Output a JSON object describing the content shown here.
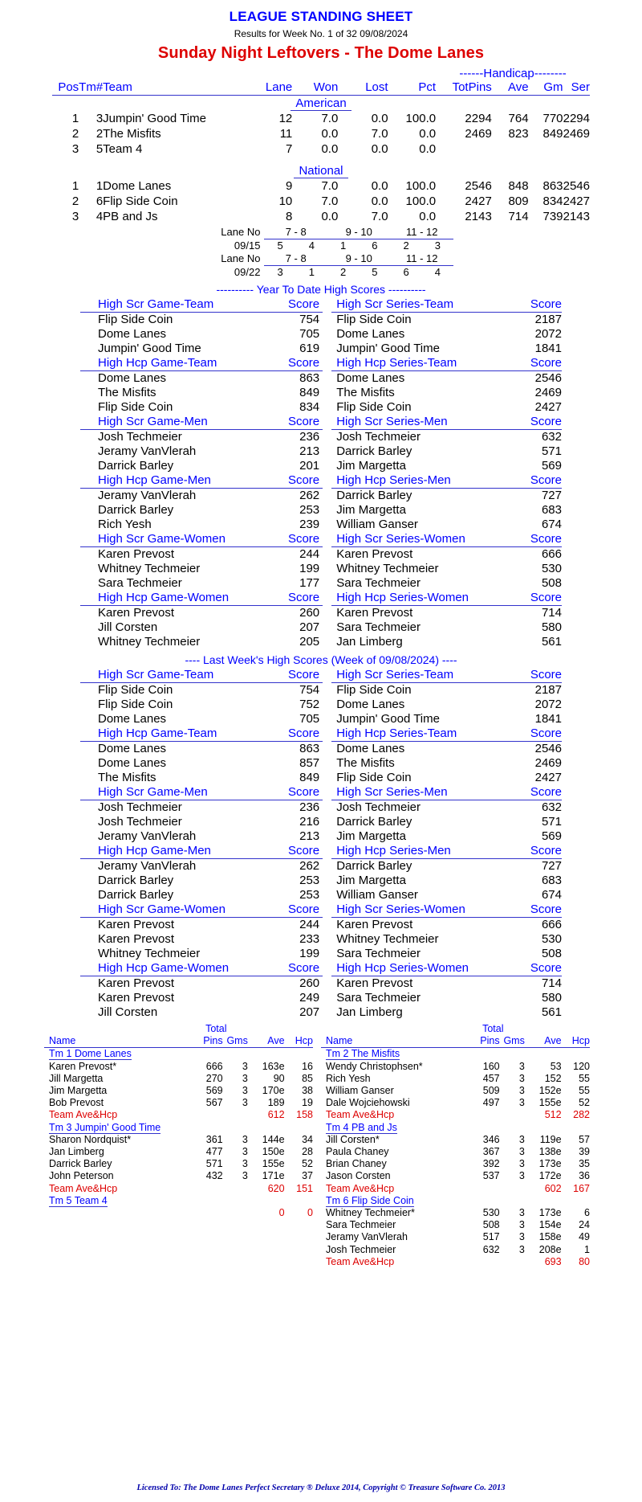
{
  "header": {
    "title": "LEAGUE STANDING SHEET",
    "subtitle": "Results for Week No. 1 of 32    09/08/2024",
    "league": "Sunday Night Leftovers - The Dome Lanes"
  },
  "standings": {
    "handicap_label": "------Handicap--------",
    "columns": {
      "pos": "Pos",
      "tm": "Tm#",
      "team": "Team",
      "lane": "Lane",
      "won": "Won",
      "lost": "Lost",
      "pct": "Pct",
      "totpins": "TotPins",
      "ave": "Ave",
      "gm": "Gm",
      "ser": "Ser"
    },
    "divisions": [
      {
        "name": "American",
        "rows": [
          {
            "pos": "1",
            "tm": "3",
            "team": "Jumpin' Good Time",
            "lane": "12",
            "won": "7.0",
            "lost": "0.0",
            "pct": "100.0",
            "totpins": "2294",
            "ave": "764",
            "gm": "770",
            "ser": "2294"
          },
          {
            "pos": "2",
            "tm": "2",
            "team": "The Misfits",
            "lane": "11",
            "won": "0.0",
            "lost": "7.0",
            "pct": "0.0",
            "totpins": "2469",
            "ave": "823",
            "gm": "849",
            "ser": "2469"
          },
          {
            "pos": "3",
            "tm": "5",
            "team": "Team 4",
            "lane": "7",
            "won": "0.0",
            "lost": "0.0",
            "pct": "0.0",
            "totpins": "",
            "ave": "",
            "gm": "",
            "ser": ""
          }
        ]
      },
      {
        "name": "National",
        "rows": [
          {
            "pos": "1",
            "tm": "1",
            "team": "Dome Lanes",
            "lane": "9",
            "won": "7.0",
            "lost": "0.0",
            "pct": "100.0",
            "totpins": "2546",
            "ave": "848",
            "gm": "863",
            "ser": "2546"
          },
          {
            "pos": "2",
            "tm": "6",
            "team": "Flip Side Coin",
            "lane": "10",
            "won": "7.0",
            "lost": "0.0",
            "pct": "100.0",
            "totpins": "2427",
            "ave": "809",
            "gm": "834",
            "ser": "2427"
          },
          {
            "pos": "3",
            "tm": "4",
            "team": "PB and Js",
            "lane": "8",
            "won": "0.0",
            "lost": "7.0",
            "pct": "0.0",
            "totpins": "2143",
            "ave": "714",
            "gm": "739",
            "ser": "2143"
          }
        ]
      }
    ]
  },
  "lane_schedule": {
    "lane_label": "Lane No",
    "pairs": [
      "7 - 8",
      "9 - 10",
      "11 - 12"
    ],
    "weeks": [
      {
        "date": "09/15",
        "teams": [
          "5",
          "4",
          "1",
          "6",
          "2",
          "3"
        ]
      },
      {
        "date": "09/22",
        "teams": [
          "3",
          "1",
          "2",
          "5",
          "6",
          "4"
        ]
      }
    ]
  },
  "ytd": {
    "banner": "---------- Year To Date High Scores ----------",
    "score_label": "Score",
    "blocks": [
      {
        "left_title": "High Scr Game-Team",
        "right_title": "High Scr Series-Team",
        "rows": [
          {
            "ln": "Flip Side Coin",
            "ls": "754",
            "rn": "Flip Side Coin",
            "rs": "2187"
          },
          {
            "ln": "",
            "ls": "",
            "rn": "",
            "rs": ""
          },
          {
            "ln": "Dome Lanes",
            "ls": "705",
            "rn": "Dome Lanes",
            "rs": "2072"
          },
          {
            "ln": "Jumpin' Good Time",
            "ls": "619",
            "rn": "Jumpin' Good Time",
            "rs": "1841"
          }
        ]
      },
      {
        "left_title": "High Hcp Game-Team",
        "right_title": "High Hcp Series-Team",
        "rows": [
          {
            "ln": "Dome Lanes",
            "ls": "863",
            "rn": "Dome Lanes",
            "rs": "2546"
          },
          {
            "ln": "The Misfits",
            "ls": "849",
            "rn": "The Misfits",
            "rs": "2469"
          },
          {
            "ln": "Flip Side Coin",
            "ls": "834",
            "rn": "Flip Side Coin",
            "rs": "2427"
          }
        ]
      },
      {
        "left_title": "High Scr Game-Men",
        "right_title": "High Scr Series-Men",
        "rows": [
          {
            "ln": "Josh Techmeier",
            "ls": "236",
            "rn": "Josh Techmeier",
            "rs": "632"
          },
          {
            "ln": "Jeramy VanVlerah",
            "ls": "213",
            "rn": "Darrick Barley",
            "rs": "571"
          },
          {
            "ln": "Darrick Barley",
            "ls": "201",
            "rn": "Jim Margetta",
            "rs": "569"
          }
        ]
      },
      {
        "left_title": "High Hcp Game-Men",
        "right_title": "High Hcp Series-Men",
        "rows": [
          {
            "ln": "Jeramy VanVlerah",
            "ls": "262",
            "rn": "Darrick Barley",
            "rs": "727"
          },
          {
            "ln": "Darrick Barley",
            "ls": "253",
            "rn": "Jim Margetta",
            "rs": "683"
          },
          {
            "ln": "Rich Yesh",
            "ls": "239",
            "rn": "William Ganser",
            "rs": "674"
          }
        ]
      },
      {
        "left_title": "High Scr Game-Women",
        "right_title": "High Scr Series-Women",
        "rows": [
          {
            "ln": "Karen Prevost",
            "ls": "244",
            "rn": "Karen Prevost",
            "rs": "666"
          },
          {
            "ln": "Whitney Techmeier",
            "ls": "199",
            "rn": "Whitney Techmeier",
            "rs": "530"
          },
          {
            "ln": "Sara Techmeier",
            "ls": "177",
            "rn": "Sara Techmeier",
            "rs": "508"
          }
        ]
      },
      {
        "left_title": "High Hcp Game-Women",
        "right_title": "High Hcp Series-Women",
        "rows": [
          {
            "ln": "Karen Prevost",
            "ls": "260",
            "rn": "Karen Prevost",
            "rs": "714"
          },
          {
            "ln": "Jill Corsten",
            "ls": "207",
            "rn": "Sara Techmeier",
            "rs": "580"
          },
          {
            "ln": "Whitney Techmeier",
            "ls": "205",
            "rn": "Jan Limberg",
            "rs": "561"
          }
        ]
      }
    ]
  },
  "lastweek": {
    "banner": "----  Last Week's High Scores   (Week of 09/08/2024)  ----",
    "score_label": "Score",
    "blocks": [
      {
        "left_title": "High Scr Game-Team",
        "right_title": "High Scr Series-Team",
        "rows": [
          {
            "ln": "Flip Side Coin",
            "ls": "754",
            "rn": "Flip Side Coin",
            "rs": "2187"
          },
          {
            "ln": "Flip Side Coin",
            "ls": "752",
            "rn": "Dome Lanes",
            "rs": "2072"
          },
          {
            "ln": "Dome Lanes",
            "ls": "705",
            "rn": "Jumpin' Good Time",
            "rs": "1841"
          }
        ]
      },
      {
        "left_title": "High Hcp Game-Team",
        "right_title": "High Hcp Series-Team",
        "rows": [
          {
            "ln": "Dome Lanes",
            "ls": "863",
            "rn": "Dome Lanes",
            "rs": "2546"
          },
          {
            "ln": "Dome Lanes",
            "ls": "857",
            "rn": "The Misfits",
            "rs": "2469"
          },
          {
            "ln": "The Misfits",
            "ls": "849",
            "rn": "Flip Side Coin",
            "rs": "2427"
          }
        ]
      },
      {
        "left_title": "High Scr Game-Men",
        "right_title": "High Scr Series-Men",
        "rows": [
          {
            "ln": "Josh Techmeier",
            "ls": "236",
            "rn": "Josh Techmeier",
            "rs": "632"
          },
          {
            "ln": "Josh Techmeier",
            "ls": "216",
            "rn": "Darrick Barley",
            "rs": "571"
          },
          {
            "ln": "Jeramy VanVlerah",
            "ls": "213",
            "rn": "Jim Margetta",
            "rs": "569"
          }
        ]
      },
      {
        "left_title": "High Hcp Game-Men",
        "right_title": "High Hcp Series-Men",
        "rows": [
          {
            "ln": "Jeramy VanVlerah",
            "ls": "262",
            "rn": "Darrick Barley",
            "rs": "727"
          },
          {
            "ln": "Darrick Barley",
            "ls": "253",
            "rn": "Jim Margetta",
            "rs": "683"
          },
          {
            "ln": "Darrick Barley",
            "ls": "253",
            "rn": "William Ganser",
            "rs": "674"
          }
        ]
      },
      {
        "left_title": "High Scr Game-Women",
        "right_title": "High Scr Series-Women",
        "rows": [
          {
            "ln": "Karen Prevost",
            "ls": "244",
            "rn": "Karen Prevost",
            "rs": "666"
          },
          {
            "ln": "Karen Prevost",
            "ls": "233",
            "rn": "Whitney Techmeier",
            "rs": "530"
          },
          {
            "ln": "Whitney Techmeier",
            "ls": "199",
            "rn": "Sara Techmeier",
            "rs": "508"
          }
        ]
      },
      {
        "left_title": "High Hcp Game-Women",
        "right_title": "High Hcp Series-Women",
        "rows": [
          {
            "ln": "Karen Prevost",
            "ls": "260",
            "rn": "Karen Prevost",
            "rs": "714"
          },
          {
            "ln": "Karen Prevost",
            "ls": "249",
            "rn": "Sara Techmeier",
            "rs": "580"
          },
          {
            "ln": "Jill Corsten",
            "ls": "207",
            "rn": "Jan Limberg",
            "rs": "561"
          }
        ]
      }
    ]
  },
  "rosters": {
    "total_label": "Total",
    "columns": {
      "name": "Name",
      "pins": "Pins",
      "gms": "Gms",
      "ave": "Ave",
      "hcp": "Hcp"
    },
    "team_total_label": "Team Ave&Hcp",
    "left": [
      {
        "team": "Tm 1 Dome Lanes",
        "players": [
          {
            "name": "Karen Prevost*",
            "pins": "666",
            "gms": "3",
            "ave": "163e",
            "hcp": "16"
          },
          {
            "name": "Jill Margetta",
            "pins": "270",
            "gms": "3",
            "ave": "90",
            "hcp": "85"
          },
          {
            "name": "Jim Margetta",
            "pins": "569",
            "gms": "3",
            "ave": "170e",
            "hcp": "38"
          },
          {
            "name": "Bob Prevost",
            "pins": "567",
            "gms": "3",
            "ave": "189",
            "hcp": "19"
          }
        ],
        "total_ave": "612",
        "total_hcp": "158"
      },
      {
        "team": "Tm 3 Jumpin' Good Time",
        "players": [
          {
            "name": "Sharon Nordquist*",
            "pins": "361",
            "gms": "3",
            "ave": "144e",
            "hcp": "34"
          },
          {
            "name": "Jan Limberg",
            "pins": "477",
            "gms": "3",
            "ave": "150e",
            "hcp": "28"
          },
          {
            "name": "",
            "pins": "",
            "gms": "",
            "ave": "",
            "hcp": ""
          },
          {
            "name": "Darrick Barley",
            "pins": "571",
            "gms": "3",
            "ave": "155e",
            "hcp": "52"
          },
          {
            "name": "John Peterson",
            "pins": "432",
            "gms": "3",
            "ave": "171e",
            "hcp": "37"
          }
        ],
        "total_ave": "620",
        "total_hcp": "151"
      },
      {
        "team": "Tm 5 Team 4",
        "players": [
          {
            "name": "",
            "pins": "",
            "gms": "",
            "ave": "",
            "hcp": ""
          }
        ],
        "total_ave": "0",
        "total_hcp": "0",
        "no_total_label": true
      }
    ],
    "right": [
      {
        "team": "Tm 2 The Misfits",
        "players": [
          {
            "name": "Wendy Christophsen*",
            "pins": "160",
            "gms": "3",
            "ave": "53",
            "hcp": "120"
          },
          {
            "name": "Rich Yesh",
            "pins": "457",
            "gms": "3",
            "ave": "152",
            "hcp": "55"
          },
          {
            "name": "William Ganser",
            "pins": "509",
            "gms": "3",
            "ave": "152e",
            "hcp": "55"
          },
          {
            "name": "Dale Wojciehowski",
            "pins": "497",
            "gms": "3",
            "ave": "155e",
            "hcp": "52"
          }
        ],
        "total_ave": "512",
        "total_hcp": "282"
      },
      {
        "team": "Tm 4 PB and Js",
        "players": [
          {
            "name": "Jill Corsten*",
            "pins": "346",
            "gms": "3",
            "ave": "119e",
            "hcp": "57"
          },
          {
            "name": "Paula Chaney",
            "pins": "367",
            "gms": "3",
            "ave": "138e",
            "hcp": "39"
          },
          {
            "name": "",
            "pins": "",
            "gms": "",
            "ave": "",
            "hcp": ""
          },
          {
            "name": "Brian Chaney",
            "pins": "392",
            "gms": "3",
            "ave": "173e",
            "hcp": "35"
          },
          {
            "name": "Jason Corsten",
            "pins": "537",
            "gms": "3",
            "ave": "172e",
            "hcp": "36"
          }
        ],
        "total_ave": "602",
        "total_hcp": "167"
      },
      {
        "team": "Tm 6 Flip Side Coin",
        "players": [
          {
            "name": "Whitney Techmeier*",
            "pins": "530",
            "gms": "3",
            "ave": "173e",
            "hcp": "6"
          },
          {
            "name": "Sara Techmeier",
            "pins": "508",
            "gms": "3",
            "ave": "154e",
            "hcp": "24"
          },
          {
            "name": "",
            "pins": "",
            "gms": "",
            "ave": "",
            "hcp": ""
          },
          {
            "name": "Jeramy VanVlerah",
            "pins": "517",
            "gms": "3",
            "ave": "158e",
            "hcp": "49"
          },
          {
            "name": "Josh Techmeier",
            "pins": "632",
            "gms": "3",
            "ave": "208e",
            "hcp": "1"
          }
        ],
        "total_ave": "693",
        "total_hcp": "80"
      }
    ]
  },
  "footer": "Licensed To: The Dome Lanes     Perfect Secretary ® Deluxe  2014, Copyright © Treasure Software Co. 2013"
}
